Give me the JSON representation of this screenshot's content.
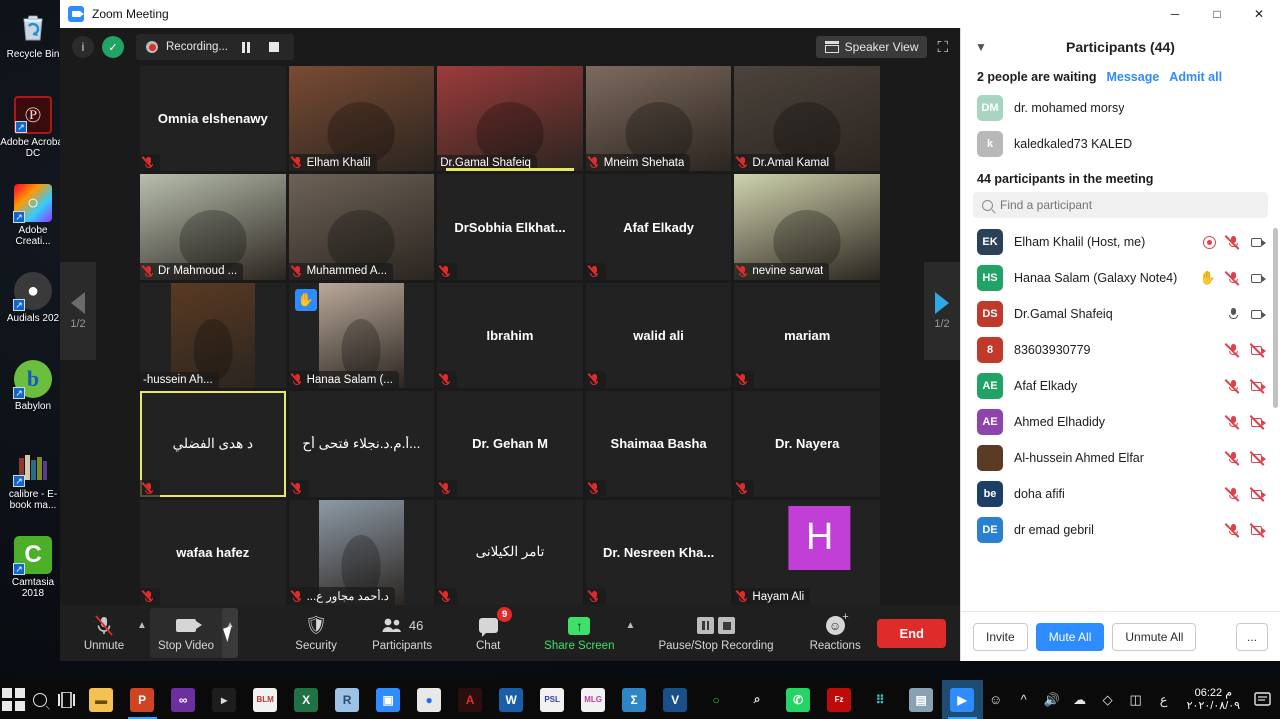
{
  "desktop": {
    "icons": [
      {
        "label": "Recycle Bin",
        "name": "recycle-bin",
        "shortcut": false
      },
      {
        "label": "Adobe Acrobat DC",
        "name": "adobe-acrobat-dc",
        "shortcut": true
      },
      {
        "label": "Adobe Creati...",
        "name": "adobe-creative-cloud",
        "shortcut": true
      },
      {
        "label": "Audials 202",
        "name": "audials-2020",
        "shortcut": true
      },
      {
        "label": "Babylon",
        "name": "babylon",
        "shortcut": true
      },
      {
        "label": "calibre - E-book ma...",
        "name": "calibre-ebook-management",
        "shortcut": true
      },
      {
        "label": "Camtasia 2018",
        "name": "camtasia-2018",
        "shortcut": true
      }
    ]
  },
  "window": {
    "title": "Zoom Meeting",
    "minimize": "─",
    "maximize": "□",
    "close": "✕"
  },
  "topbar": {
    "info_icon": "i",
    "encryption_icon": "shield-check",
    "recording_label": "Recording...",
    "pause_recording_icon": "pause-icon",
    "stop_recording_icon": "stop-icon",
    "view_label": "Speaker View",
    "fullscreen_icon": "enter-fullscreen-icon"
  },
  "gallery": {
    "prev_page_label": "1/2",
    "next_page_label": "1/2",
    "tiles": [
      {
        "name": "Omnia elshenawy",
        "display": "center",
        "video": false,
        "muted": true,
        "rtl": false
      },
      {
        "name": "Elham Khalil",
        "display": "badge",
        "video": true,
        "muted": true,
        "rtl": false,
        "bg": "#7a4b33"
      },
      {
        "name": "Dr.Gamal Shafeiq",
        "display": "badge",
        "video": true,
        "muted": false,
        "rtl": false,
        "bg": "#9c3b3b",
        "highlight": true
      },
      {
        "name": "Mneim Shehata",
        "display": "badge",
        "video": true,
        "muted": true,
        "rtl": false,
        "bg": "#7d6a5e"
      },
      {
        "name": "Dr.Amal Kamal",
        "display": "badge",
        "video": true,
        "muted": true,
        "rtl": false,
        "bg": "#4b433c"
      },
      {
        "name": "Dr Mahmoud ...",
        "display": "badge",
        "video": true,
        "muted": true,
        "rtl": false,
        "bg": "#b8bfae"
      },
      {
        "name": "Muhammed A...",
        "display": "badge",
        "video": true,
        "muted": true,
        "rtl": false,
        "bg": "#6d6257"
      },
      {
        "name": "DrSobhia  Elkhat...",
        "display": "center",
        "video": false,
        "muted": true,
        "rtl": false
      },
      {
        "name": "Afaf Elkady",
        "display": "center",
        "video": false,
        "muted": true,
        "rtl": false
      },
      {
        "name": "nevine sarwat",
        "display": "badge",
        "video": true,
        "muted": true,
        "rtl": false,
        "bg": "#cfd3ad"
      },
      {
        "name": "-hussein Ah...",
        "display": "badge",
        "video": true,
        "muted": false,
        "rtl": false,
        "bg": "#5a3a22",
        "thumb": true
      },
      {
        "name": "Hanaa Salam (...",
        "display": "badge",
        "video": true,
        "muted": true,
        "rtl": false,
        "bg": "#b9a99a",
        "thumb": true,
        "hand": true
      },
      {
        "name": "Ibrahim",
        "display": "center",
        "video": false,
        "muted": true,
        "rtl": false
      },
      {
        "name": "walid ali",
        "display": "center",
        "video": false,
        "muted": true,
        "rtl": false
      },
      {
        "name": "mariam",
        "display": "center",
        "video": false,
        "muted": true,
        "rtl": false
      },
      {
        "name": "د هدى الفضلي",
        "display": "center",
        "video": false,
        "muted": true,
        "rtl": true,
        "selected": true
      },
      {
        "name": "...أ.م.د.نجلاء فتحى أح",
        "display": "center",
        "video": false,
        "muted": true,
        "rtl": true
      },
      {
        "name": "Dr. Gehan M",
        "display": "center",
        "video": false,
        "muted": true,
        "rtl": false
      },
      {
        "name": "Shaimaa Basha",
        "display": "center",
        "video": false,
        "muted": true,
        "rtl": false
      },
      {
        "name": "Dr. Nayera",
        "display": "center",
        "video": false,
        "muted": true,
        "rtl": false
      },
      {
        "name": "wafaa hafez",
        "display": "center",
        "video": false,
        "muted": true,
        "rtl": false
      },
      {
        "name": "د.أحمد مجاور ع...",
        "display": "badge",
        "video": true,
        "muted": true,
        "rtl": true,
        "bg": "#8d9aa6",
        "thumb": true
      },
      {
        "name": "تامر الكيلانى",
        "display": "center",
        "video": false,
        "muted": true,
        "rtl": true
      },
      {
        "name": "Dr. Nesreen Kha...",
        "display": "center",
        "video": false,
        "muted": true,
        "rtl": false
      },
      {
        "name": "Hayam Ali",
        "display": "badge",
        "video": false,
        "muted": true,
        "rtl": false,
        "avatar_letter": "H",
        "avatar_color": "#c13fd6"
      }
    ]
  },
  "controls": {
    "mic_label": "Unmute",
    "video_label": "Stop Video",
    "security_label": "Security",
    "participants_label": "Participants",
    "participants_count": "46",
    "chat_label": "Chat",
    "chat_badge": "9",
    "share_label": "Share Screen",
    "recording_label": "Pause/Stop Recording",
    "reactions_label": "Reactions",
    "end_label": "End"
  },
  "panel": {
    "title": "Participants (44)",
    "collapse_icon": "chevron-down-icon",
    "waiting_text": "2 people are waiting",
    "message_label": "Message",
    "admit_all_label": "Admit all",
    "waiting_list": [
      {
        "name": "dr. mohamed morsy",
        "initials": "DM",
        "color": "#a8d5c2"
      },
      {
        "name": "kaledkaled73 KALED",
        "initials": "k",
        "color": "#b8b8b8"
      }
    ],
    "section_header": "44 participants in the meeting",
    "search_placeholder": "Find a participant",
    "participants": [
      {
        "name": "Elham Khalil (Host, me)",
        "initials": "EK",
        "color": "#2a4157",
        "recording": true,
        "mic": "muted",
        "cam": "on",
        "hand": false
      },
      {
        "name": "Hanaa Salam (Galaxy Note4)",
        "initials": "HS",
        "color": "#21a366",
        "recording": false,
        "mic": "muted",
        "cam": "on",
        "hand": true
      },
      {
        "name": "Dr.Gamal Shafeiq",
        "initials": "DS",
        "color": "#c0392b",
        "recording": false,
        "mic": "on",
        "cam": "on",
        "hand": false
      },
      {
        "name": "83603930779",
        "initials": "8",
        "color": "#c0392b",
        "recording": false,
        "mic": "muted",
        "cam": "off",
        "hand": false
      },
      {
        "name": "Afaf Elkady",
        "initials": "AE",
        "color": "#21a366",
        "recording": false,
        "mic": "muted",
        "cam": "off",
        "hand": false
      },
      {
        "name": "Ahmed Elhadidy",
        "initials": "AE",
        "color": "#8e44ad",
        "recording": false,
        "mic": "muted",
        "cam": "off",
        "hand": false
      },
      {
        "name": "Al-hussein Ahmed Elfar",
        "initials": "",
        "color": "#5a3a22",
        "recording": false,
        "mic": "muted",
        "cam": "off",
        "hand": false,
        "photo": true
      },
      {
        "name": "doha afifi",
        "initials": "be",
        "color": "#1c3f66",
        "recording": false,
        "mic": "muted",
        "cam": "off",
        "hand": false
      },
      {
        "name": "dr emad gebril",
        "initials": "DE",
        "color": "#2980d0",
        "recording": false,
        "mic": "muted",
        "cam": "off",
        "hand": false
      }
    ],
    "footer": {
      "invite_label": "Invite",
      "mute_all_label": "Mute All",
      "unmute_all_label": "Unmute All",
      "more_label": "..."
    }
  },
  "taskbar": {
    "start_icon": "windows-logo-icon",
    "search_icon": "search-icon",
    "taskview_icon": "task-view-icon",
    "pinned": [
      {
        "name": "file-explorer",
        "glyph": "▬",
        "color": "#f4c153",
        "text": "#6b4c00"
      },
      {
        "name": "powerpoint",
        "glyph": "P",
        "color": "#d04423",
        "text": "#fff"
      },
      {
        "name": "visual-studio",
        "glyph": "∞",
        "color": "#6b2fa0",
        "text": "#fff"
      },
      {
        "name": "command-prompt",
        "glyph": "▸",
        "color": "#1d1d1d",
        "text": "#d8d8d8"
      },
      {
        "name": "blm-document",
        "glyph": "BLM",
        "color": "#f2f2f2",
        "text": "#c0392b"
      },
      {
        "name": "excel",
        "glyph": "X",
        "color": "#1f7244",
        "text": "#fff"
      },
      {
        "name": "r-statistics",
        "glyph": "R",
        "color": "#9cc3e5",
        "text": "#2a4d6e"
      },
      {
        "name": "id-app",
        "glyph": "▣",
        "color": "#2d8cff",
        "text": "#fff"
      },
      {
        "name": "google-chrome",
        "glyph": "●",
        "color": "#e8e8e8",
        "text": "#1a73e8"
      },
      {
        "name": "adobe-acrobat",
        "glyph": "A",
        "color": "#2b0e0e",
        "text": "#e02b2b"
      },
      {
        "name": "word",
        "glyph": "W",
        "color": "#1b5ea8",
        "text": "#fff"
      },
      {
        "name": "psl-document",
        "glyph": "PSL",
        "color": "#f2f2f2",
        "text": "#2b3fc0"
      },
      {
        "name": "mlg-document",
        "glyph": "MLG",
        "color": "#f2f2f2",
        "text": "#c03fa0"
      },
      {
        "name": "spss",
        "glyph": "Σ",
        "color": "#2f86c5",
        "text": "#fff"
      },
      {
        "name": "visio",
        "glyph": "V",
        "color": "#1b4f8a",
        "text": "#fff"
      },
      {
        "name": "nvivo",
        "glyph": "○",
        "color": "#0a0a0a",
        "text": "#2ecc40"
      },
      {
        "name": "magnifier-tool",
        "glyph": "⌕",
        "color": "#0a0a0a",
        "text": "#e8e8e8"
      },
      {
        "name": "whatsapp",
        "glyph": "✆",
        "color": "#25d366",
        "text": "#fff"
      },
      {
        "name": "filezilla",
        "glyph": "Fz",
        "color": "#bf0a0a",
        "text": "#fff"
      },
      {
        "name": "dots-app",
        "glyph": "⠿",
        "color": "#0a0a0a",
        "text": "#2fd0d0"
      },
      {
        "name": "photo-viewer",
        "glyph": "▤",
        "color": "#8aa0b5",
        "text": "#fff"
      },
      {
        "name": "zoom",
        "glyph": "▶",
        "color": "#2d8cff",
        "text": "#fff"
      }
    ],
    "tray": {
      "people_icon": "people-icon",
      "chevron_icon": "show-hidden-icons-chevron",
      "volume_icon": "volume-icon",
      "onedrive_icon": "onedrive-icon",
      "dropbox_icon": "dropbox-icon",
      "battery_icon": "battery-icon",
      "language": "ع",
      "time": "06:22 م",
      "date": "٢٠٢٠/٠٨/٠٩",
      "notification_icon": "action-center-icon",
      "notification_count": "0"
    }
  }
}
